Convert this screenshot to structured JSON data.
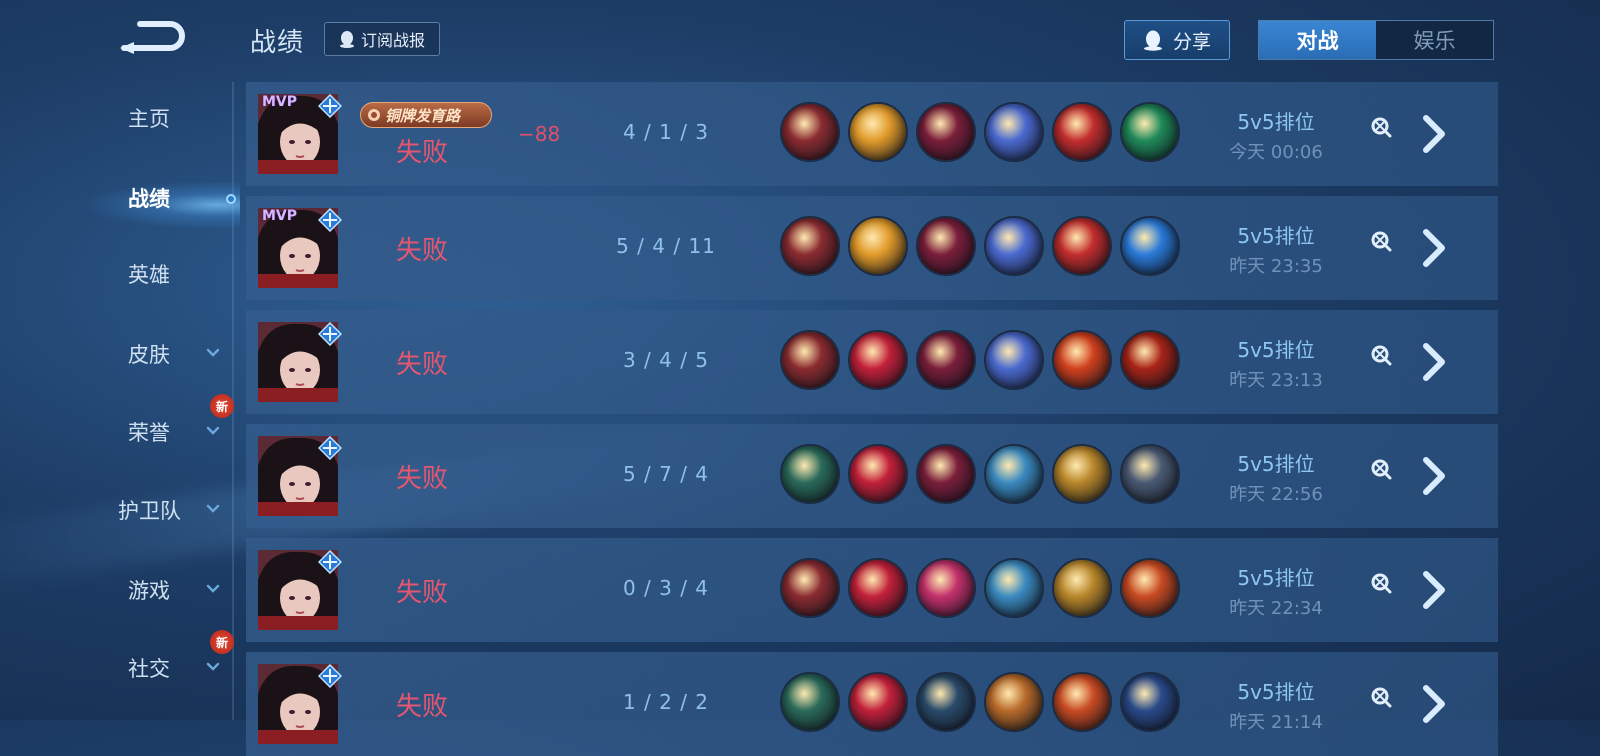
{
  "header": {
    "title": "战绩",
    "subscribe_label": "订阅战报",
    "share_label": "分享",
    "tabs": [
      {
        "label": "对战",
        "active": true
      },
      {
        "label": "娱乐",
        "active": false
      }
    ]
  },
  "sidebar": {
    "items": [
      {
        "label": "主页",
        "has_chevron": false,
        "is_new": false,
        "active": false
      },
      {
        "label": "战绩",
        "has_chevron": false,
        "is_new": false,
        "active": true
      },
      {
        "label": "英雄",
        "has_chevron": false,
        "is_new": false,
        "active": false
      },
      {
        "label": "皮肤",
        "has_chevron": true,
        "is_new": false,
        "active": false
      },
      {
        "label": "荣誉",
        "has_chevron": true,
        "is_new": true,
        "active": false
      },
      {
        "label": "护卫队",
        "has_chevron": true,
        "is_new": false,
        "active": false
      },
      {
        "label": "游戏",
        "has_chevron": true,
        "is_new": false,
        "active": false
      },
      {
        "label": "社交",
        "has_chevron": true,
        "is_new": true,
        "active": false
      }
    ],
    "new_badge_label": "新"
  },
  "matches": [
    {
      "mvp": true,
      "badge": "铜牌发育路",
      "result": "失败",
      "delta": "−88",
      "kda": "4 / 1 / 3",
      "mode": "5v5排位",
      "time": "今天 00:06",
      "items": [
        "#8a2b30",
        "#e09a2a",
        "#7a1e3a",
        "#4a6ad0",
        "#c22d2d",
        "#1f8a5a"
      ]
    },
    {
      "mvp": true,
      "badge": "",
      "result": "失败",
      "delta": "",
      "kda": "5 / 4 / 11",
      "mode": "5v5排位",
      "time": "昨天 23:35",
      "items": [
        "#8a2b30",
        "#e09a2a",
        "#7a1e3a",
        "#4a6ad0",
        "#c22d2d",
        "#2a7ad8"
      ]
    },
    {
      "mvp": false,
      "badge": "",
      "result": "失败",
      "delta": "",
      "kda": "3 / 4 / 5",
      "mode": "5v5排位",
      "time": "昨天 23:13",
      "items": [
        "#8a2b30",
        "#c2203a",
        "#7a1e3a",
        "#4a6ad0",
        "#d0401e",
        "#a82418"
      ]
    },
    {
      "mvp": false,
      "badge": "",
      "result": "失败",
      "delta": "",
      "kda": "5 / 7 / 4",
      "mode": "5v5排位",
      "time": "昨天 22:56",
      "items": [
        "#2a6a5a",
        "#c2203a",
        "#7a1e3a",
        "#3a8ac0",
        "#b8862a",
        "#4a5a74"
      ]
    },
    {
      "mvp": false,
      "badge": "",
      "result": "失败",
      "delta": "",
      "kda": "0 / 3 / 4",
      "mode": "5v5排位",
      "time": "昨天 22:34",
      "items": [
        "#8a2b30",
        "#c2203a",
        "#c2306a",
        "#3a8ac0",
        "#b8862a",
        "#c84a22"
      ]
    },
    {
      "mvp": false,
      "badge": "",
      "result": "失败",
      "delta": "",
      "kda": "1 / 2 / 2",
      "mode": "5v5排位",
      "time": "昨天 21:14",
      "items": [
        "#2a6a5a",
        "#c2203a",
        "#2a4a6a",
        "#b86a2a",
        "#c84a22",
        "#2a4a8a"
      ]
    }
  ],
  "labels": {
    "mvp": "MVP"
  },
  "colors": {
    "accent": "#3a86d3",
    "loss": "#e5566f",
    "kda": "#8ec0ea",
    "panel": "#345c8c"
  }
}
